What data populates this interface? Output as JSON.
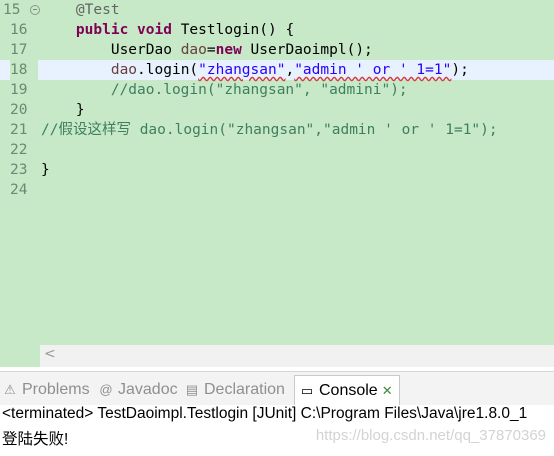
{
  "editor": {
    "lines": [
      {
        "num": "15",
        "segments": [
          [
            "ann",
            "    @Test"
          ]
        ]
      },
      {
        "num": "16",
        "segments": [
          [
            "",
            "    "
          ],
          [
            "kw",
            "public"
          ],
          [
            "",
            " "
          ],
          [
            "kw",
            "void"
          ],
          [
            "",
            " Testlogin() {"
          ]
        ]
      },
      {
        "num": "17",
        "segments": [
          [
            "",
            "        UserDao "
          ],
          [
            "var",
            "dao"
          ],
          [
            "",
            "="
          ],
          [
            "kw",
            "new"
          ],
          [
            "",
            " UserDaoimpl();"
          ]
        ]
      },
      {
        "num": "18",
        "segments": [
          [
            "",
            "        "
          ],
          [
            "var",
            "dao"
          ],
          [
            "",
            ".login("
          ],
          [
            "str",
            "\"zhangsan\""
          ],
          [
            "",
            ","
          ],
          [
            "str",
            "\"admin ' or ' 1=1\""
          ],
          [
            "",
            ");"
          ]
        ]
      },
      {
        "num": "19",
        "segments": [
          [
            "cmt",
            "        //dao.login(\"zhangsan\", \"admini\");"
          ]
        ]
      },
      {
        "num": "20",
        "segments": [
          [
            "",
            "    }"
          ]
        ]
      },
      {
        "num": "21",
        "segments": [
          [
            "cmt",
            "//假设这样写 dao.login(\"zhangsan\",\"admin ' or ' 1=1\");"
          ]
        ]
      },
      {
        "num": "22",
        "segments": [
          [
            "",
            ""
          ]
        ]
      },
      {
        "num": "23",
        "segments": [
          [
            "",
            "}"
          ]
        ]
      },
      {
        "num": "24",
        "segments": [
          [
            "",
            ""
          ]
        ]
      }
    ],
    "scroll_left_glyph": "<"
  },
  "tabs": [
    {
      "label": "Problems",
      "icon": "problems-icon",
      "glyph": "⚠"
    },
    {
      "label": "Javadoc",
      "icon": "javadoc-icon",
      "glyph": "@"
    },
    {
      "label": "Declaration",
      "icon": "declaration-icon",
      "glyph": "▤"
    },
    {
      "label": "Console",
      "icon": "console-icon",
      "glyph": "▭",
      "active": true,
      "close": "✕"
    }
  ],
  "console": {
    "status": "<terminated> TestDaoimpl.Testlogin [JUnit] C:\\Program Files\\Java\\jre1.8.0_1",
    "output": "登陆失败!",
    "watermark": "https://blog.csdn.net/qq_37870369"
  },
  "colors": {
    "editor_bg": "#c7e9c8",
    "current_line": "#e8f2fe",
    "keyword": "#7f0055",
    "string": "#2a00ff",
    "comment": "#3f7f5f"
  }
}
